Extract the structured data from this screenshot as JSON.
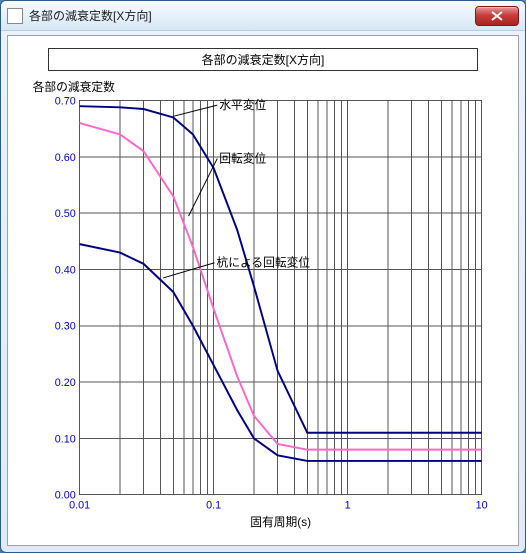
{
  "window": {
    "title": "各部の減衰定数[X方向]"
  },
  "chart_title": "各部の減衰定数[X方向]",
  "ylabel": "各部の減衰定数",
  "xlabel": "固有周期(s)",
  "colors": {
    "horizontal": "#000080",
    "rotation": "#ff66cc",
    "pile_rotation": "#000080",
    "grid": "#555555",
    "axis_text": "#0000cc"
  },
  "chart_data": {
    "type": "line",
    "xscale": "log",
    "xlim": [
      0.01,
      10
    ],
    "ylim": [
      0.0,
      0.7
    ],
    "xticks_major": [
      0.01,
      0.1,
      1,
      10
    ],
    "xtick_labels": [
      "0.01",
      "0.1",
      "1",
      "10"
    ],
    "yticks": [
      0.0,
      0.1,
      0.2,
      0.3,
      0.4,
      0.5,
      0.6,
      0.7
    ],
    "ytick_labels": [
      "0.00",
      "0.10",
      "0.20",
      "0.30",
      "0.40",
      "0.50",
      "0.60",
      "0.70"
    ],
    "series": [
      {
        "name": "水平変位",
        "color_key": "horizontal",
        "x": [
          0.01,
          0.02,
          0.03,
          0.05,
          0.07,
          0.1,
          0.15,
          0.2,
          0.3,
          0.5,
          0.7,
          1.0,
          2.0,
          5.0,
          10.0
        ],
        "y": [
          0.69,
          0.688,
          0.685,
          0.67,
          0.64,
          0.58,
          0.47,
          0.37,
          0.22,
          0.11,
          0.11,
          0.11,
          0.11,
          0.11,
          0.11
        ]
      },
      {
        "name": "回転変位",
        "color_key": "rotation",
        "x": [
          0.01,
          0.02,
          0.03,
          0.05,
          0.07,
          0.1,
          0.15,
          0.2,
          0.3,
          0.5,
          0.7,
          1.0,
          2.0,
          5.0,
          10.0
        ],
        "y": [
          0.66,
          0.64,
          0.61,
          0.53,
          0.44,
          0.33,
          0.21,
          0.14,
          0.09,
          0.08,
          0.08,
          0.08,
          0.08,
          0.08,
          0.08
        ]
      },
      {
        "name": "杭による回転変位",
        "color_key": "pile_rotation",
        "x": [
          0.01,
          0.02,
          0.03,
          0.05,
          0.07,
          0.1,
          0.15,
          0.2,
          0.3,
          0.5,
          0.7,
          1.0,
          2.0,
          5.0,
          10.0
        ],
        "y": [
          0.445,
          0.43,
          0.41,
          0.36,
          0.3,
          0.23,
          0.15,
          0.1,
          0.07,
          0.06,
          0.06,
          0.06,
          0.06,
          0.06,
          0.06
        ]
      }
    ],
    "annotations": [
      {
        "text": "水平変位",
        "series": 0,
        "at_x": 0.11,
        "at_y": 0.685,
        "line_to_x": 0.05,
        "line_to_y": 0.672
      },
      {
        "text": "回転変位",
        "series": 1,
        "at_x": 0.11,
        "at_y": 0.59,
        "line_to_x": 0.065,
        "line_to_y": 0.495
      },
      {
        "text": "杭による回転変位",
        "series": 2,
        "at_x": 0.105,
        "at_y": 0.405,
        "line_to_x": 0.042,
        "line_to_y": 0.385
      }
    ]
  }
}
